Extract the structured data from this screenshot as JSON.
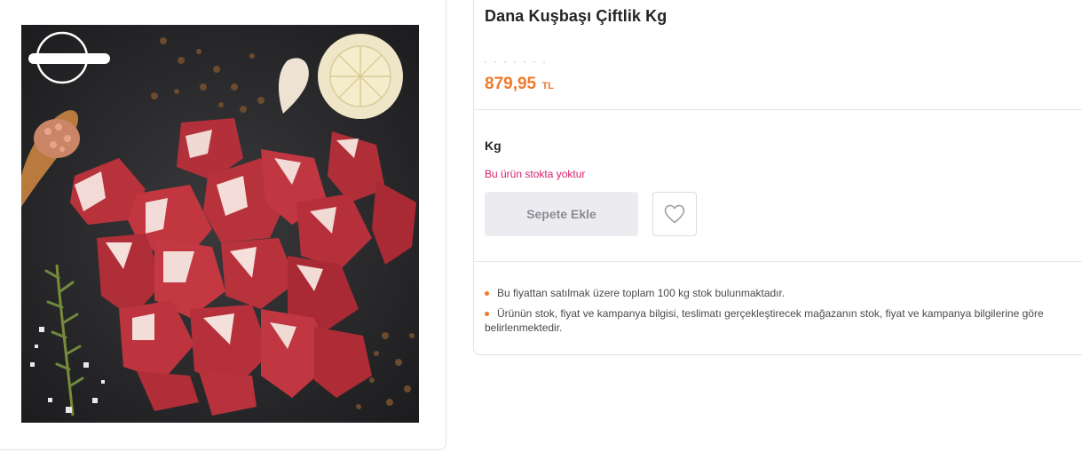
{
  "product": {
    "title": "Dana Kuşbaşı Çiftlik Kg",
    "image_alt": "Dana kuşbaşı et, sarımsak, biberiye ve baharatlar",
    "image_subject": "diced-raw-beef-photo",
    "price_amount": "879,95",
    "price_currency": "TL",
    "unit_label": "Kg",
    "stock_status": "Bu ürün stokta yoktur",
    "add_to_cart_label": "Sepete Ekle",
    "favorite_icon": "heart-icon"
  },
  "notes": [
    "Bu fiyattan satılmak üzere toplam 100 kg stok bulunmaktadır.",
    "Ürünün stok, fiyat ve kampanya bilgisi, teslimatı gerçekleştirecek mağazanın stok, fiyat ve kampanya bilgilerine göre belirlenmektedir."
  ],
  "colors": {
    "price": "#f07a2b",
    "stock_status": "#d6206e",
    "button_bg": "#ececf0",
    "bullet": "#f07a2b"
  }
}
